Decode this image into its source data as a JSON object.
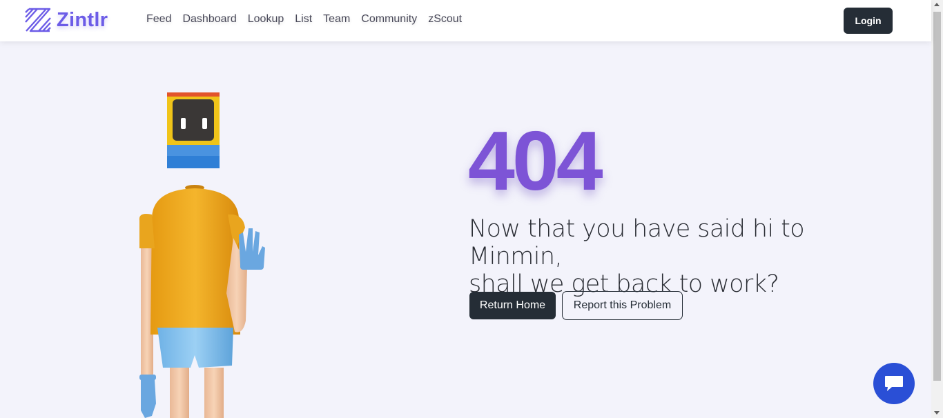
{
  "brand": {
    "name": "Zintlr"
  },
  "nav": {
    "items": [
      "Feed",
      "Dashboard",
      "Lookup",
      "List",
      "Team",
      "Community",
      "zScout"
    ]
  },
  "header": {
    "login_label": "Login"
  },
  "error": {
    "code": "404",
    "message_line1": "Now that you have said hi to Minmin,",
    "message_line2": "shall we get back to work?"
  },
  "actions": {
    "return_home_label": "Return Home",
    "report_label": "Report this Problem"
  },
  "colors": {
    "brand": "#6c5ce7",
    "error_code": "#7d54d6",
    "dark_button": "#252d36",
    "chat_button": "#2a4fd6",
    "background": "#f3f3fb"
  },
  "icons": {
    "brand_logo": "zintlr-logo-icon",
    "chat": "chat-bubble-icon"
  }
}
